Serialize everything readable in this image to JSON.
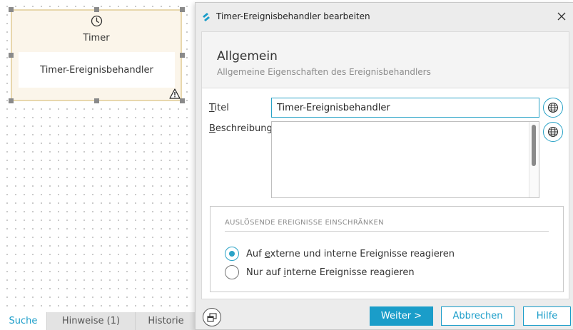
{
  "canvas": {
    "node": {
      "icon": "clock-icon",
      "type_label": "Timer",
      "name": "Timer-Ereignisbehandler",
      "warning_icon": "warning-icon"
    }
  },
  "bottom_tabs": [
    {
      "label": "Suche",
      "active": true
    },
    {
      "label": "Hinweise (1)",
      "active": false
    },
    {
      "label": "Historie",
      "active": false
    }
  ],
  "dialog": {
    "title": "Timer-Ereignisbehandler bearbeiten",
    "header": {
      "title": "Allgemein",
      "subtitle": "Allgemeine Eigenschaften des Ereignisbehandlers"
    },
    "fields": {
      "title_label_mnemonic": "T",
      "title_label_rest": "itel",
      "title_value": "Timer-Ereignisbehandler",
      "desc_label_mnemonic": "B",
      "desc_label_rest": "eschreibung",
      "desc_value": ""
    },
    "restrict_group": {
      "title": "AUSLÖSENDE EREIGNISSE EINSCHRÄNKEN",
      "options": [
        {
          "pre": "Auf ",
          "mnemonic": "e",
          "post": "xterne und interne Ereignisse reagieren",
          "checked": true
        },
        {
          "pre": "Nur auf ",
          "mnemonic": "i",
          "post": "nterne Ereignisse reagieren",
          "checked": false
        }
      ]
    },
    "buttons": {
      "next": "Weiter >",
      "cancel": "Abbrechen",
      "help": "Hilfe"
    }
  },
  "colors": {
    "accent": "#1a9dc9",
    "node_fill": "#fbf5ea",
    "node_border": "#e8d7ad"
  }
}
